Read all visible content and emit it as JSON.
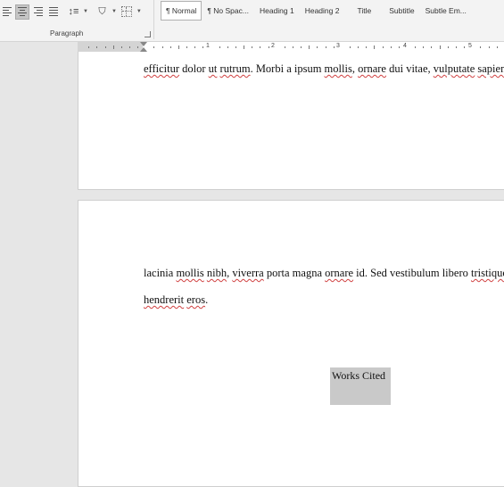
{
  "ribbon": {
    "paragraph_group_label": "Paragraph",
    "styles": [
      "¶ Normal",
      "¶ No Spac...",
      "Heading 1",
      "Heading 2",
      "Title",
      "Subtitle",
      "Subtle Em..."
    ],
    "selected_style": "¶ Normal",
    "icons": [
      "align-left-icon",
      "align-center-icon",
      "align-right-icon",
      "justify-icon",
      "line-spacing-icon",
      "shading-icon",
      "borders-icon",
      "dialog-launcher-icon"
    ]
  },
  "ruler": {
    "numbers": [
      "1",
      "2",
      "3",
      "4",
      "5"
    ]
  },
  "page1": {
    "line1": [
      "efficitur",
      " dolor ",
      "ut",
      " ",
      "rutrum",
      ". Morbi a ipsum ",
      "mollis",
      ", ",
      "ornare",
      " dui vitae, ",
      "vulputate",
      " ",
      "sapien"
    ]
  },
  "page2": {
    "line1": [
      "lacinia ",
      "mollis",
      " ",
      "nibh",
      ", ",
      "viverra",
      " porta magna ",
      "ornare",
      " id. Sed vestibulum libero ",
      "tristique"
    ],
    "line2": [
      "hendrerit",
      " ",
      "eros",
      "."
    ],
    "works_cited": "Works Cited"
  }
}
